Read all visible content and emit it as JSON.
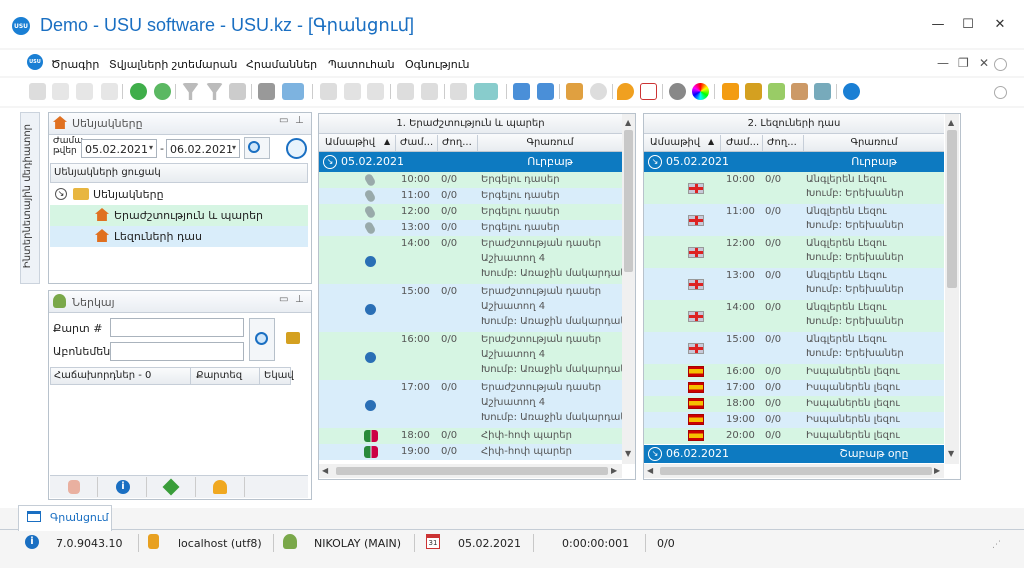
{
  "window": {
    "title": "Demo - USU software - USU.kz - [Գրանցում]",
    "logo_text": "USU",
    "minimize": "—",
    "maximize": "☐",
    "close": "✕"
  },
  "menu": {
    "items": [
      "Ծրագիր",
      "Տվյալների շտեմարան",
      "Հրամաններ",
      "Պատուհան",
      "Օգնություն"
    ],
    "mdi_minimize": "—",
    "mdi_restore": "❐",
    "mdi_close": "✕"
  },
  "sidebar_tab": {
    "label": "Ինտերնետային մեդիատոր"
  },
  "rooms_panel": {
    "title": "Սենյակները",
    "period_label": "Ժամա\nթվեր",
    "date_from": "05.02.2021",
    "date_to": "06.02.2021",
    "dash": "-",
    "list_header": "Սենյակների ցուցակ",
    "root_label": "Սենյակները",
    "items": [
      "Երաժշտություն և պարեր",
      "Լեզուների դաս"
    ]
  },
  "login_panel": {
    "title": "Ներկայ",
    "card_label": "Քարտ #",
    "subscription_label": "Աբոնեմենտ",
    "card_value": "",
    "subscription_value": "",
    "columns": [
      "Հաճախորդներ - 0",
      "Քարտեզ",
      "Եկավ"
    ]
  },
  "schedule_music": {
    "title": "1. Երաժշտություն և պարեր",
    "columns": [
      "Ամսաթիվ",
      "Ժամ...",
      "Ժող...",
      "Գրառում"
    ],
    "group_date": "05.02.2021",
    "group_day": "Ուրբաթ",
    "rows": [
      {
        "time": "10:00",
        "count": "0/0",
        "note": "Երգելու դասեր",
        "icon": "microphone",
        "color": "green"
      },
      {
        "time": "11:00",
        "count": "0/0",
        "note": "Երգելու դասեր",
        "icon": "microphone",
        "color": "blue"
      },
      {
        "time": "12:00",
        "count": "0/0",
        "note": "Երգելու դասեր",
        "icon": "microphone",
        "color": "green"
      },
      {
        "time": "13:00",
        "count": "0/0",
        "note": "Երգելու դասեր",
        "icon": "microphone",
        "color": "blue"
      },
      {
        "time": "14:00",
        "count": "0/0",
        "note": "Երաժշտության դասեր",
        "note2": "Աշխատող 4",
        "note3": "Խումբ: Առաջին մակարդակ",
        "icon": "guitar",
        "color": "green"
      },
      {
        "time": "15:00",
        "count": "0/0",
        "note": "Երաժշտության դասեր",
        "note2": "Աշխատող 4",
        "note3": "Խումբ: Առաջին մակարդակ",
        "icon": "guitar",
        "color": "blue"
      },
      {
        "time": "16:00",
        "count": "0/0",
        "note": "Երաժշտության դասեր",
        "note2": "Աշխատող 4",
        "note3": "Խումբ: Առաջին մակարդակ",
        "icon": "guitar",
        "color": "green"
      },
      {
        "time": "17:00",
        "count": "0/0",
        "note": "Երաժշտության դասեր",
        "note2": "Աշխատող 4",
        "note3": "Խումբ: Առաջին մակարդակ",
        "icon": "guitar",
        "color": "blue"
      },
      {
        "time": "18:00",
        "count": "0/0",
        "note": "Հիփ-հոփ պարեր",
        "icon": "dancers",
        "color": "green"
      },
      {
        "time": "19:00",
        "count": "0/0",
        "note": "Հիփ-հոփ պարեր",
        "icon": "dancers",
        "color": "blue"
      }
    ]
  },
  "schedule_lang": {
    "title": "2. Լեզուների դաս",
    "columns": [
      "Ամսաթիվ",
      "Ժամ...",
      "Ժող...",
      "Գրառում"
    ],
    "group_date": "05.02.2021",
    "group_day": "Ուրբաթ",
    "next_group_date": "06.02.2021",
    "next_group_day": "Շաբաթ օրը",
    "rows": [
      {
        "time": "10:00",
        "count": "0/0",
        "note": "Անգլերեն Լեզու",
        "note2": "Խումբ: Երեխաներ",
        "flag": "uk",
        "color": "green"
      },
      {
        "time": "11:00",
        "count": "0/0",
        "note": "Անգլերեն Լեզու",
        "note2": "Խումբ: Երեխաներ",
        "flag": "uk",
        "color": "blue"
      },
      {
        "time": "12:00",
        "count": "0/0",
        "note": "Անգլերեն Լեզու",
        "note2": "Խումբ: Երեխաներ",
        "flag": "uk",
        "color": "green"
      },
      {
        "time": "13:00",
        "count": "0/0",
        "note": "Անգլերեն Լեզու",
        "note2": "Խումբ: Երեխաներ",
        "flag": "uk",
        "color": "blue"
      },
      {
        "time": "14:00",
        "count": "0/0",
        "note": "Անգլերեն Լեզու",
        "note2": "Խումբ: Երեխաներ",
        "flag": "uk",
        "color": "green"
      },
      {
        "time": "15:00",
        "count": "0/0",
        "note": "Անգլերեն Լեզու",
        "note2": "Խումբ: Երեխաներ",
        "flag": "uk",
        "color": "blue"
      },
      {
        "time": "16:00",
        "count": "0/0",
        "note": "Իսպաներեն լեզու",
        "flag": "es",
        "color": "green"
      },
      {
        "time": "17:00",
        "count": "0/0",
        "note": "Իսպաներեն լեզու",
        "flag": "es",
        "color": "blue"
      },
      {
        "time": "18:00",
        "count": "0/0",
        "note": "Իսպաներեն լեզու",
        "flag": "es",
        "color": "green"
      },
      {
        "time": "19:00",
        "count": "0/0",
        "note": "Իսպաներեն լեզու",
        "flag": "es",
        "color": "blue"
      },
      {
        "time": "20:00",
        "count": "0/0",
        "note": "Իսպաներեն լեզու",
        "flag": "es",
        "color": "green"
      }
    ]
  },
  "doc_tab": {
    "label": "Գրանցում"
  },
  "status": {
    "version": "7.0.9043.10",
    "server": "localhost (utf8)",
    "user": "NIKOLAY (MAIN)",
    "date": "05.02.2021",
    "timer": "0:00:00:001",
    "counter": "0/0",
    "calendar_day": "31"
  },
  "colors": {
    "accent": "#1a7fd4",
    "selection": "#0d7ac1",
    "row_green": "#d6f5e3",
    "row_blue": "#d9edfa"
  }
}
